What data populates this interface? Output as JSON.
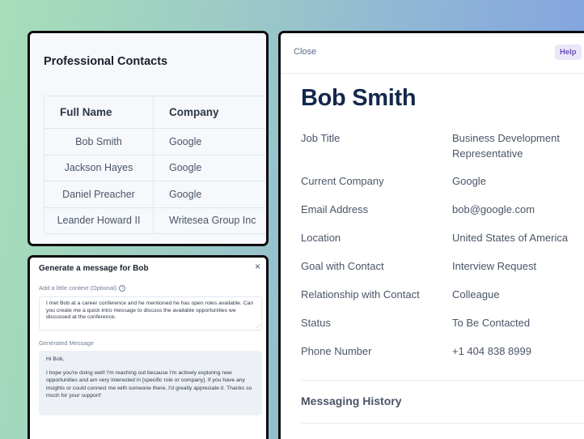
{
  "contacts": {
    "title": "Professional Contacts",
    "columns": [
      "Full Name",
      "Company"
    ],
    "rows": [
      [
        "Bob Smith",
        "Google"
      ],
      [
        "Jackson Hayes",
        "Google"
      ],
      [
        "Daniel Preacher",
        "Google"
      ],
      [
        "Leander Howard II",
        "Writesea Group Inc"
      ]
    ]
  },
  "generate": {
    "title": "Generate a message for Bob",
    "close_glyph": "×",
    "context_label": "Add a little context (Optional)",
    "context_value": "I met Bob at a career conference and he mentioned he has open roles available. Can you create me a quick intro message to discuss the available opportunities we discussed at the conference.",
    "generated_label": "Generated Message",
    "generated_greeting": "Hi Bob,",
    "generated_body": "I hope you're doing well! I'm reaching out because I'm actively exploring new opportunities and am very interested in [specific role or company]. If you have any insights or could connect me with someone there, I'd greatly appreciate it. Thanks so much for your support!"
  },
  "details": {
    "close_label": "Close",
    "help_label": "Help",
    "name": "Bob Smith",
    "fields": [
      {
        "key": "Job Title",
        "value": "Business Development Representative"
      },
      {
        "key": "Current Company",
        "value": "Google"
      },
      {
        "key": "Email Address",
        "value": "bob@google.com"
      },
      {
        "key": "Location",
        "value": "United States of America"
      },
      {
        "key": "Goal with Contact",
        "value": "Interview Request"
      },
      {
        "key": "Relationship with Contact",
        "value": "Colleague"
      },
      {
        "key": "Status",
        "value": "To Be Contacted"
      },
      {
        "key": "Phone Number",
        "value": "+1 404 838 8999"
      }
    ],
    "messaging_history_label": "Messaging History"
  }
}
